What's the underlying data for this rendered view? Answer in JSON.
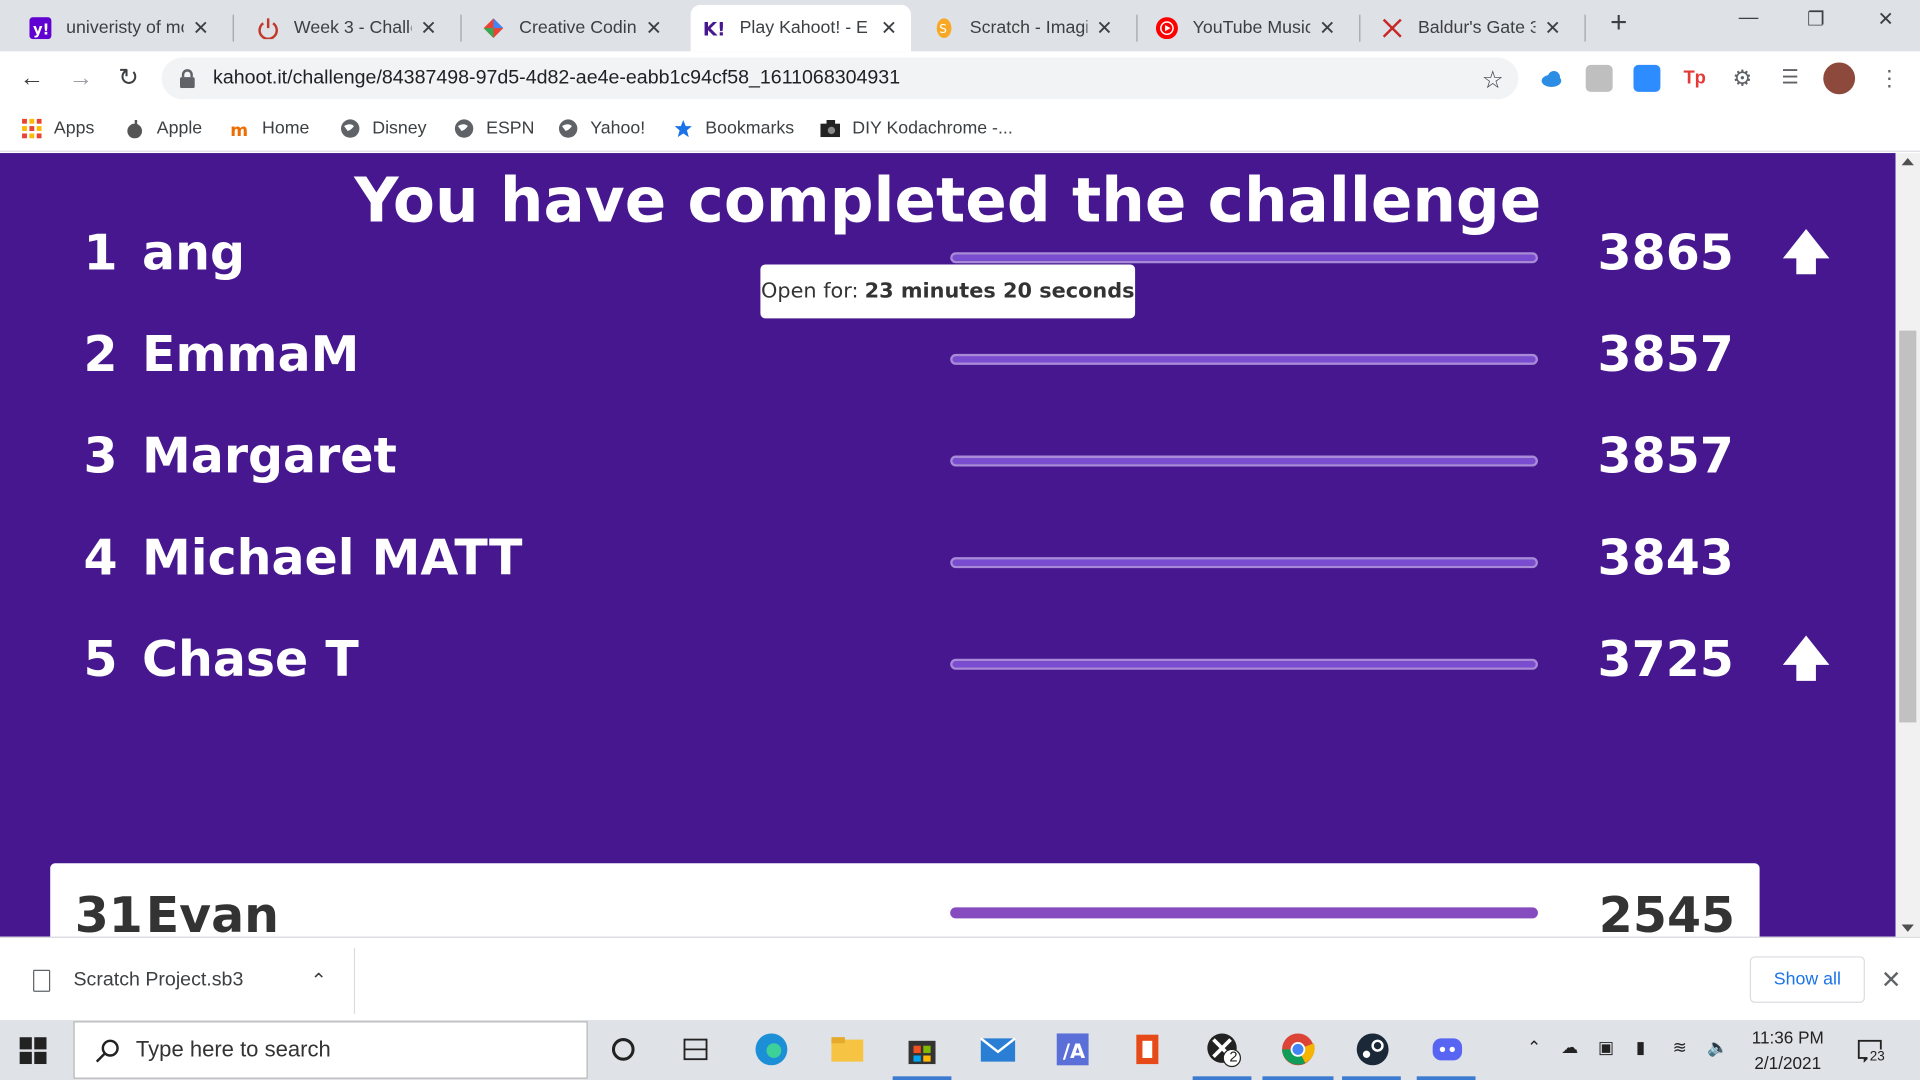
{
  "browser": {
    "tabs": [
      {
        "label": "univeristy of mo",
        "icon": "yahoo-icon",
        "color": "#6001d2",
        "active": false
      },
      {
        "label": "Week 3 - Challe",
        "icon": "power-icon",
        "color": "#c0392b",
        "active": false
      },
      {
        "label": "Creative Coding",
        "icon": "diamond-icon",
        "color": "#4285f4",
        "active": false
      },
      {
        "label": "Play Kahoot! - E",
        "icon": "kahoot-icon",
        "color": "#46178f",
        "active": true
      },
      {
        "label": "Scratch - Imagin",
        "icon": "scratch-icon",
        "color": "#f9a825",
        "active": false
      },
      {
        "label": "YouTube Music",
        "icon": "youtube-music-icon",
        "color": "#ff0000",
        "active": false
      },
      {
        "label": "Baldur's Gate 3",
        "icon": "swords-icon",
        "color": "#c62828",
        "active": false
      }
    ],
    "url": "kahoot.it/challenge/84387498-97d5-4d82-ae4e-eabb1c94cf58_1611068304931",
    "bookmarks": [
      {
        "label": "Apps",
        "icon": "apps-grid-icon"
      },
      {
        "label": "Apple",
        "icon": "apple-icon"
      },
      {
        "label": "Home",
        "icon": "home-icon"
      },
      {
        "label": "Disney",
        "icon": "globe-icon"
      },
      {
        "label": "ESPN",
        "icon": "globe-icon"
      },
      {
        "label": "Yahoo!",
        "icon": "globe-icon"
      },
      {
        "label": "Bookmarks",
        "icon": "star-icon"
      },
      {
        "label": "DIY Kodachrome -...",
        "icon": "camera-icon"
      }
    ]
  },
  "page": {
    "title": "You have completed the challenge",
    "open_for_label": "Open for:",
    "open_for_value": "23 minutes 20 seconds",
    "leaderboard": [
      {
        "rank": "1",
        "name": "ang",
        "score": "3865",
        "progress": 1.0,
        "arrow_up": true
      },
      {
        "rank": "2",
        "name": "EmmaM",
        "score": "3857",
        "progress": 1.0,
        "arrow_up": false
      },
      {
        "rank": "3",
        "name": "Margaret",
        "score": "3857",
        "progress": 1.0,
        "arrow_up": false
      },
      {
        "rank": "4",
        "name": "Michael MATT",
        "score": "3843",
        "progress": 1.0,
        "arrow_up": false
      },
      {
        "rank": "5",
        "name": "Chase T",
        "score": "3725",
        "progress": 1.0,
        "arrow_up": true
      }
    ],
    "self": {
      "rank": "31",
      "name": "Evan",
      "score": "2545",
      "progress": 1.0
    },
    "colors": {
      "background": "#46178f",
      "bar": "#864cbf"
    }
  },
  "downloads": {
    "file_name": "Scratch Project.sb3",
    "show_all": "Show all"
  },
  "taskbar": {
    "search_placeholder": "Type here to search",
    "time": "11:36 PM",
    "date": "2/1/2021",
    "notification_count": "23",
    "xbox_badge": "2"
  }
}
